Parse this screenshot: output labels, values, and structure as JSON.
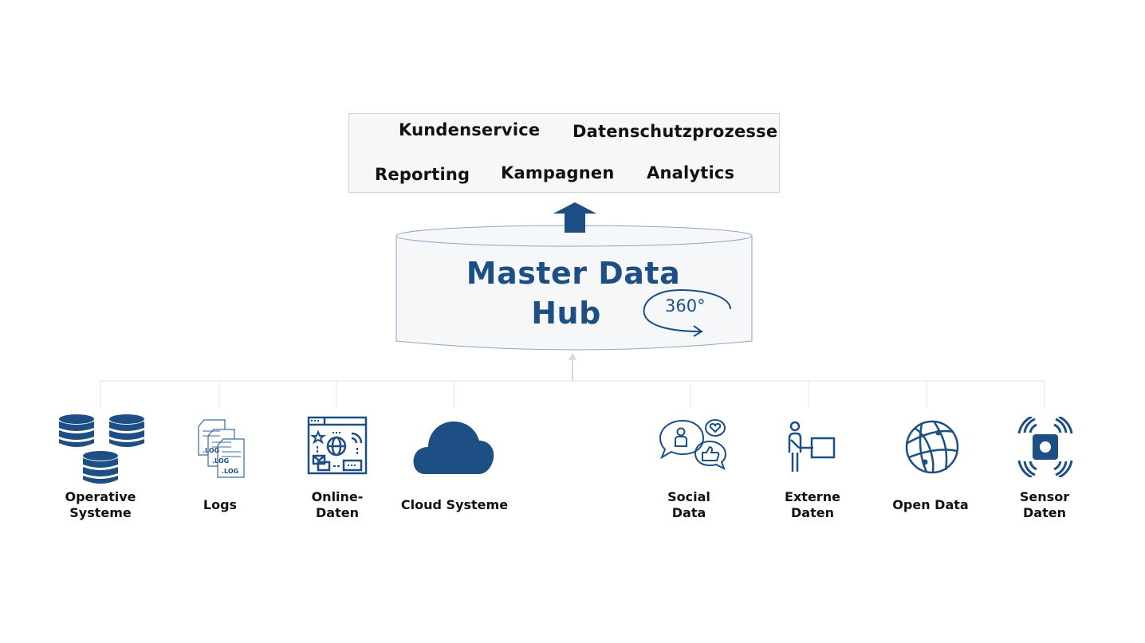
{
  "colors": {
    "brand": "#1d4f84",
    "box_fill": "#f7f7f7",
    "box_border": "#d4d4d4",
    "connector": "#dddddd",
    "text": "#111111"
  },
  "use_cases": {
    "kundenservice": "Kundenservice",
    "datenschutz": "Datenschutzprozesse",
    "reporting": "Reporting",
    "kampagnen": "Kampagnen",
    "analytics": "Analytics"
  },
  "hub": {
    "title_line1": "Master Data",
    "title_line2": "Hub",
    "badge": "360°"
  },
  "sources": [
    {
      "line1": "Operative",
      "line2": "Systeme",
      "icon": "database-stack-icon"
    },
    {
      "line1": "Logs",
      "line2": "",
      "icon": "log-files-icon"
    },
    {
      "line1": "Online-",
      "line2": "Daten",
      "icon": "web-browser-icon"
    },
    {
      "line1": "Cloud Systeme",
      "line2": "",
      "icon": "cloud-icon"
    },
    {
      "line1": "Social",
      "line2": "Data",
      "icon": "social-bubbles-icon"
    },
    {
      "line1": "Externe",
      "line2": "Daten",
      "icon": "presenter-board-icon"
    },
    {
      "line1": "Open Data",
      "line2": "",
      "icon": "globe-icon"
    },
    {
      "line1": "Sensor",
      "line2": "Daten",
      "icon": "sensor-icon"
    }
  ]
}
